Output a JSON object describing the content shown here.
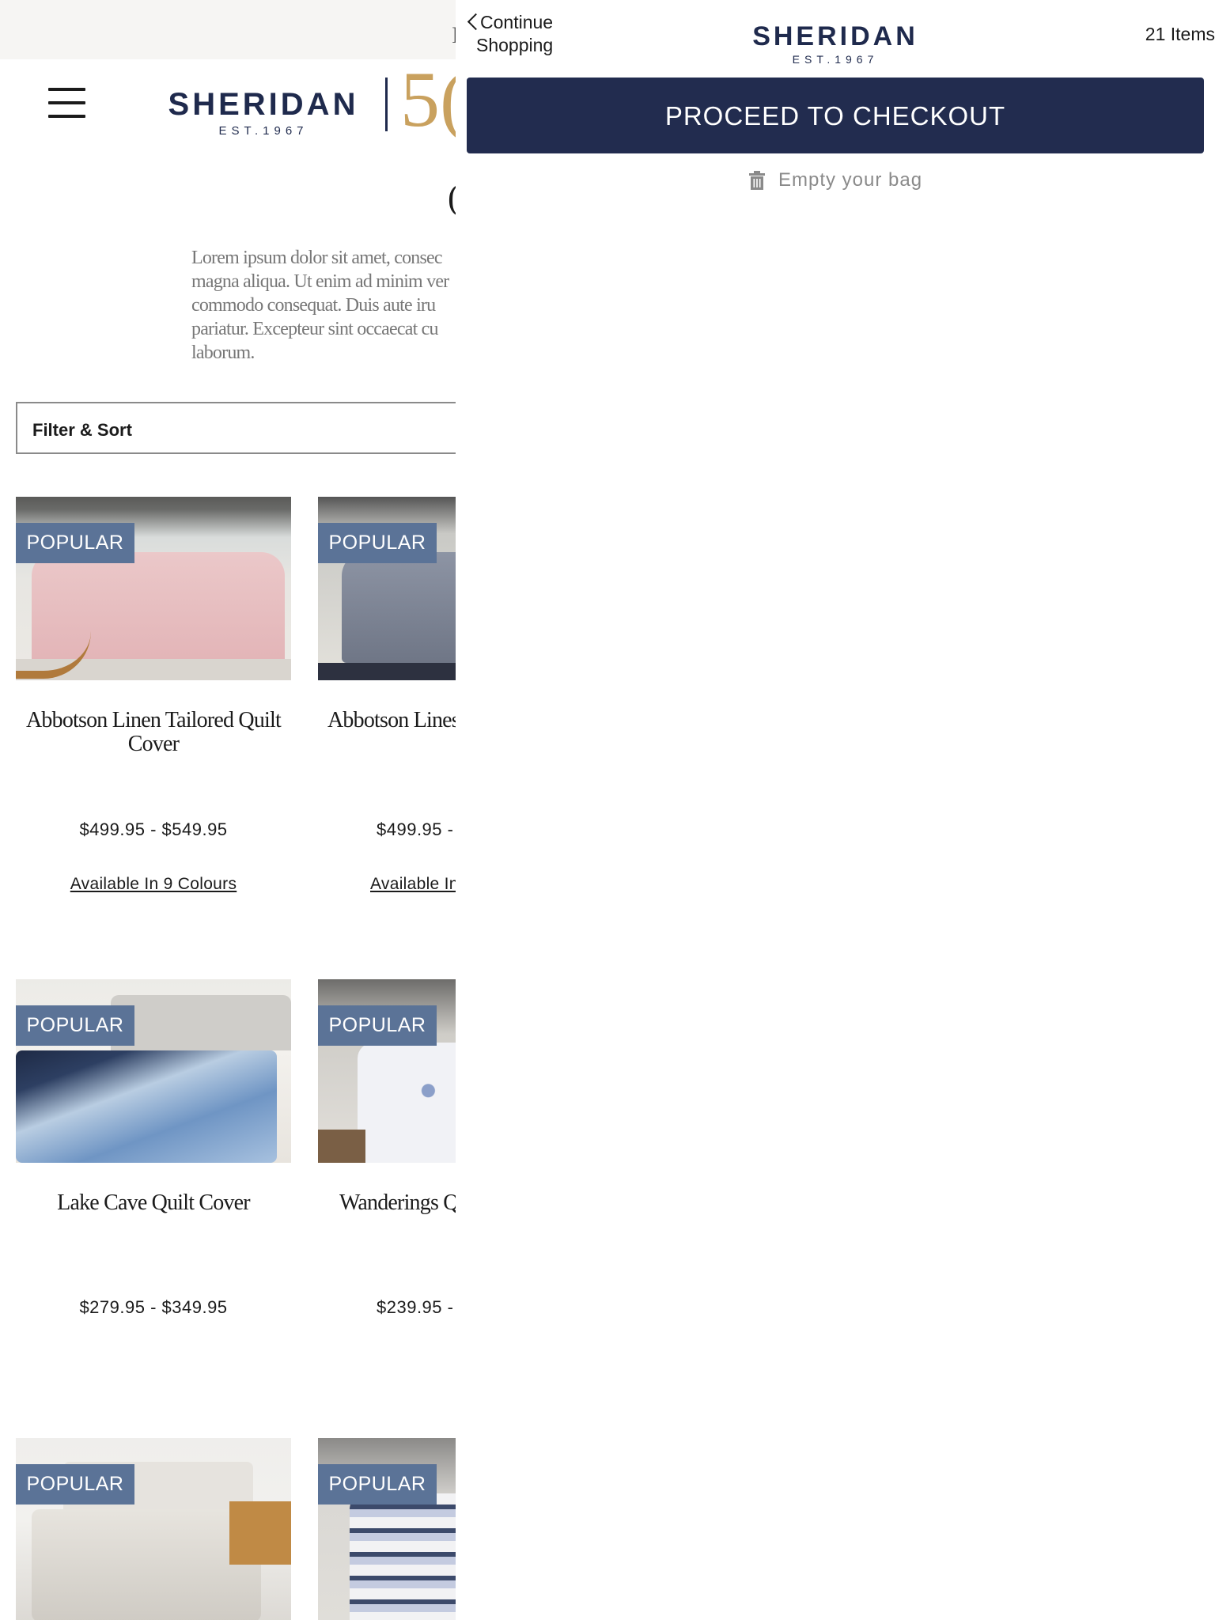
{
  "promo": {
    "glyph": "I"
  },
  "header": {
    "logo_word": "SHERIDAN",
    "logo_est": "EST.1967",
    "anniversary_glyph": "5("
  },
  "heading": {
    "glyph": "("
  },
  "intro_lines": [
    "Lorem ipsum dolor sit amet, consec",
    "magna aliqua. Ut enim ad minim ver",
    "commodo consequat. Duis aute iru",
    "pariatur. Excepteur sint occaecat cu",
    "laborum."
  ],
  "filter": {
    "label": "Filter & Sort"
  },
  "products": [
    {
      "badge": "POPULAR",
      "name": "Abbotson Linen Tailored Quilt Cover",
      "price": "$499.95 - $549.95",
      "colours": "Available In 9 Colours"
    },
    {
      "badge": "POPULAR",
      "name": "Abbotson Lines Co",
      "price": "$499.95 -",
      "colours": "Available In"
    },
    {
      "badge": "POPULAR",
      "name": "Lake Cave Quilt Cover",
      "price": "$279.95 - $349.95",
      "colours": ""
    },
    {
      "badge": "POPULAR",
      "name": "Wanderings Q",
      "price": "$239.95 -",
      "colours": ""
    },
    {
      "badge": "POPULAR",
      "name": "",
      "price": "",
      "colours": ""
    },
    {
      "badge": "POPULAR",
      "name": "",
      "price": "",
      "colours": ""
    }
  ],
  "drawer": {
    "continue_line1": "Continue",
    "continue_line2": "Shopping",
    "logo_word": "SHERIDAN",
    "logo_est": "EST.1967",
    "items_count": "21 Items",
    "checkout_label": "PROCEED TO CHECKOUT",
    "empty_label": "Empty your bag"
  },
  "colors": {
    "brand_navy": "#222c4f",
    "badge_blue": "#5b7397",
    "gold": "#c9a15e"
  },
  "icons": [
    "hamburger-icon",
    "chevron-left-icon",
    "trash-icon"
  ]
}
